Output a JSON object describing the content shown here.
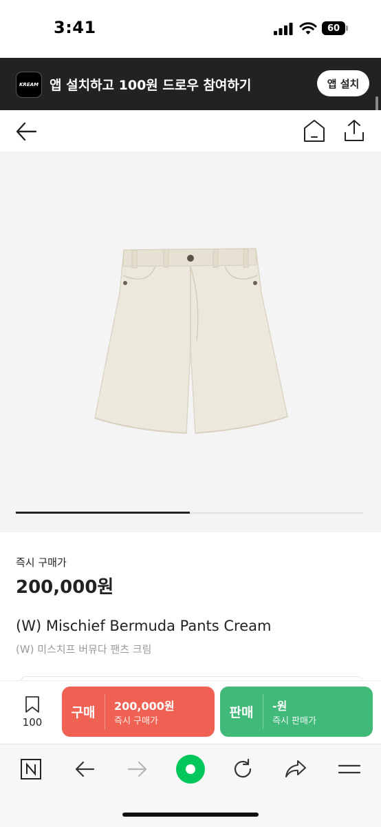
{
  "status_bar": {
    "time": "3:41",
    "battery": "60"
  },
  "banner": {
    "logo_text": "KREAM",
    "text": "앱 설치하고 100원 드로우 참여하기",
    "button_label": "앱 설치"
  },
  "gallery": {
    "progress_fraction": 0.5
  },
  "product": {
    "price_label": "즉시 구매가",
    "price": "200,000원",
    "name_en": "(W) Mischief Bermuda Pants Cream",
    "name_ko": "(W) 미스치프 버뮤다 팬츠 크림"
  },
  "action_bar": {
    "wish_count": "100",
    "buy": {
      "label": "구매",
      "price": "200,000원",
      "sub": "즉시 구매가"
    },
    "sell": {
      "label": "판매",
      "price": "-원",
      "sub": "즉시 판매가"
    }
  },
  "browser": {
    "accent": "#03c75a"
  },
  "colors": {
    "buy": "#ef6253",
    "sell": "#41b979",
    "banner": "#222222"
  }
}
